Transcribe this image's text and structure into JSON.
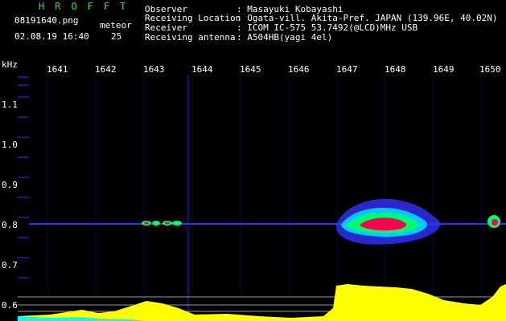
{
  "header": {
    "brand": "HROFFT",
    "filename": "08191640.png",
    "datetime": "02.08.19 16:40",
    "meteor_label": "meteor",
    "meteor_count": "25",
    "observer_label": "Observer",
    "observer_value": ": Masayuki Kobayashi",
    "location_label": "Receiving Location",
    "location_value": ": Ogata-vill. Akita-Pref. JAPAN (139.96E, 40.02N)",
    "receiver_label": "Receiver",
    "receiver_value": ": ICOM IC-575 53.7492(@LCD)MHz USB",
    "antenna_label": "Receiving antenna",
    "antenna_value": ": A504HB(yagi 4el)"
  },
  "axis": {
    "unit": "kHz",
    "time_ticks": [
      "1641",
      "1642",
      "1643",
      "1644",
      "1645",
      "1646",
      "1647",
      "1648",
      "1649",
      "1650"
    ],
    "freq_ticks": [
      "1.1",
      "1.0",
      "0.9",
      "0.8",
      "0.7",
      "0.6"
    ]
  },
  "colors": {
    "background": "#000000",
    "noise": "#0a0a50",
    "signal_blue": "#3232ff",
    "signal_green": "#00ff66",
    "signal_red": "#ff0050",
    "meteor_bar": "#ffff00",
    "baseline": "#00ffff"
  }
}
